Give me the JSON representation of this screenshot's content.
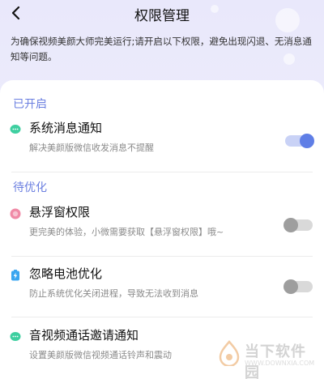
{
  "header": {
    "title": "权限管理",
    "back_icon": "chevron-left-icon"
  },
  "notice": "为确保视频美颜大师完美运行;请开启以下权限，避免出现闪退、无消息通知等问题。",
  "sections": {
    "enabled": {
      "title": "已开启",
      "items": [
        {
          "name": "系统消息通知",
          "desc": "解决美颜版微信收发消息不提醒",
          "icon": "chat-bubble-icon",
          "state": "on"
        }
      ]
    },
    "pending": {
      "title": "待优化",
      "items": [
        {
          "name": "悬浮窗权限",
          "desc": "更完美的体验，小微需要获取【悬浮窗权限】哦~",
          "icon": "floating-window-icon",
          "state": "off"
        },
        {
          "name": "忽略电池优化",
          "desc": "防止系统优化关闭进程，导致无法收到消息",
          "icon": "battery-icon",
          "state": "off"
        },
        {
          "name": "音视频通话邀请通知",
          "desc": "设置美颜版微信视频通话铃声和震动",
          "icon": "chat-bubble-icon",
          "state": "none"
        }
      ]
    }
  },
  "colors": {
    "accent": "#6b7fe0",
    "toggle_on": "#5f7ee6",
    "toggle_off": "#9e9e9e",
    "chat_icon": "#3ecfa0",
    "floating_icon": "#f08aa6",
    "battery_icon": "#3aa6f0"
  },
  "watermark": {
    "text": "当下软件园",
    "url": "WWW.DOWNXIA.COM"
  }
}
